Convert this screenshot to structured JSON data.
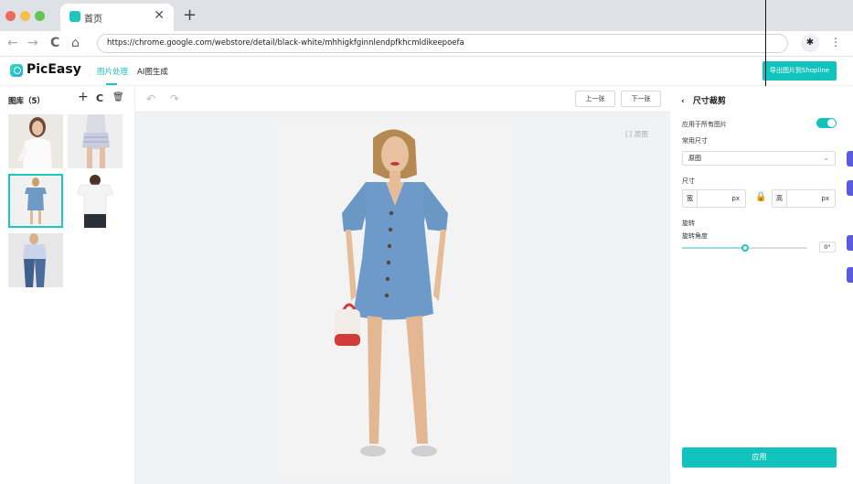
{
  "browser": {
    "tab_title": "首页",
    "tab_close": "✕",
    "new_tab": "+",
    "url": "https://chrome.google.com/webstore/detail/black-white/mhhigkfginnlendpfkhcmldikeepoefa",
    "back": "←",
    "forward": "→",
    "reload": "C",
    "home": "⌂",
    "extensions": "✱",
    "menu": "⋮",
    "colors": {
      "close": "#ec6a5e",
      "minimize": "#f4bf4f",
      "maximize": "#61c554"
    }
  },
  "app": {
    "logo": "PicEasy",
    "nav": [
      {
        "label": "图片处理",
        "active": true
      },
      {
        "label": "AI图生成",
        "active": false
      }
    ],
    "export_label": "导出图片到Shopline",
    "accent": "#12c3bd"
  },
  "library": {
    "title": "图库（5）",
    "add": "+",
    "refresh": "C",
    "delete": "🗑",
    "thumbnails": [
      {
        "name": "white-blouse-model",
        "selected": false
      },
      {
        "name": "striped-shorts-model",
        "selected": false
      },
      {
        "name": "denim-dress-model",
        "selected": true
      },
      {
        "name": "white-tshirt-model",
        "selected": false
      },
      {
        "name": "jeans-model",
        "selected": false
      }
    ]
  },
  "canvas": {
    "undo": "↶",
    "redo": "↷",
    "prev_label": "上一张",
    "next_label": "下一张",
    "compare_label": "原图",
    "compare_icon": "⟦⟧"
  },
  "panel": {
    "back_icon": "‹",
    "title": "尺寸裁剪",
    "apply_all_label": "应用于所有图片",
    "apply_all_on": true,
    "common_size_label": "常用尺寸",
    "common_size_value": "原图",
    "size_label": "尺寸",
    "width_prefix": "宽",
    "height_prefix": "高",
    "unit": "px",
    "lock_icon": "🔒",
    "rotate_label": "旋转",
    "rotate_angle_label": "旋转角度",
    "rotate_value": "0°",
    "rotate_fraction": 0.5,
    "apply_label": "应用",
    "chevron": "⌄"
  }
}
